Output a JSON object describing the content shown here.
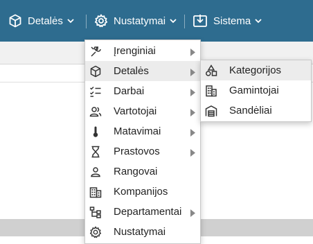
{
  "topnav": {
    "items": [
      {
        "label": "Detalės",
        "icon": "cube-icon"
      },
      {
        "label": "Nustatymai",
        "icon": "gear-icon"
      },
      {
        "label": "Sistema",
        "icon": "download-box-icon"
      }
    ],
    "colors": {
      "bar": "#2e6c8f",
      "text": "#ffffff"
    }
  },
  "menu": {
    "items": [
      {
        "label": "Įrenginiai",
        "icon": "tools-icon",
        "submenu": true
      },
      {
        "label": "Detalės",
        "icon": "cube-icon",
        "submenu": true,
        "active": true
      },
      {
        "label": "Darbai",
        "icon": "checklist-icon",
        "submenu": true
      },
      {
        "label": "Vartotojai",
        "icon": "users-icon",
        "submenu": true
      },
      {
        "label": "Matavimai",
        "icon": "thermometer-icon",
        "submenu": true
      },
      {
        "label": "Prastovos",
        "icon": "hourglass-icon",
        "submenu": true
      },
      {
        "label": "Rangovai",
        "icon": "person-icon",
        "submenu": false
      },
      {
        "label": "Kompanijos",
        "icon": "building-icon",
        "submenu": false
      },
      {
        "label": "Departamentai",
        "icon": "org-chart-icon",
        "submenu": true
      },
      {
        "label": "Nustatymai",
        "icon": "gear-icon",
        "submenu": false
      }
    ],
    "highlight_color": "#ececec"
  },
  "submenu": {
    "items": [
      {
        "label": "Kategorijos",
        "icon": "shapes-icon",
        "active": true
      },
      {
        "label": "Gamintojai",
        "icon": "factory-icon"
      },
      {
        "label": "Sandėliai",
        "icon": "warehouse-icon"
      }
    ]
  }
}
